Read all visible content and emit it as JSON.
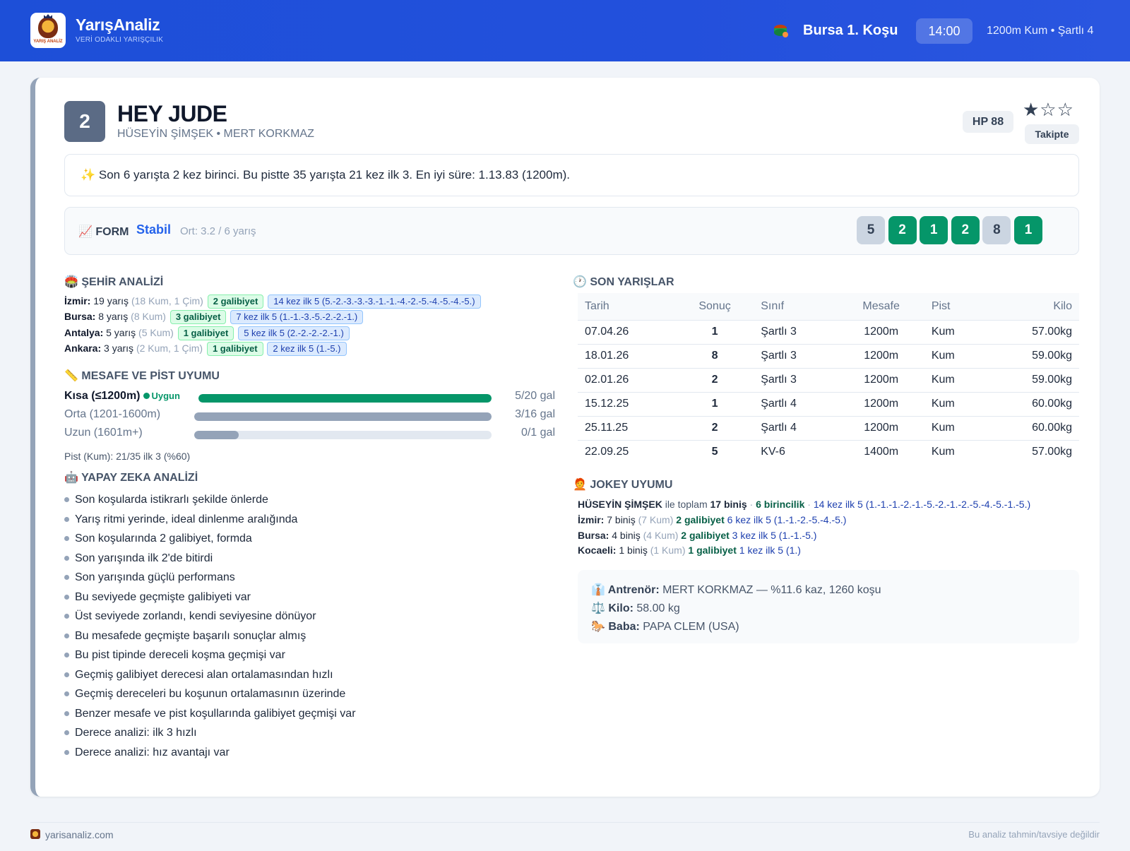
{
  "header": {
    "brand": "YarışAnaliz",
    "tagline": "VERİ ODAKLI YARIŞÇILIK",
    "logo_text": "YARIŞ ANALİZ",
    "race_title": "Bursa 1. Koşu",
    "time": "14:00",
    "race_meta": "1200m Kum • Şartlı 4"
  },
  "horse": {
    "number": "2",
    "name": "HEY JUDE",
    "subtitle": "HÜSEYİN ŞİMŞEK • MERT KORKMAZ",
    "hp": "HP 88",
    "stars": "★☆☆",
    "stars_value": 1,
    "stars_max": 3,
    "follow_label": "Takipte"
  },
  "summary": "✨ Son 6 yarışta 2 kez birinci. Bu pistte 35 yarışta 21 kez ilk 3. En iyi süre: 1.13.83 (1200m).",
  "form": {
    "label": "📈 FORM",
    "state": "Stabil",
    "avg": "Ort: 3.2 / 6 yarış",
    "results": [
      "5",
      "2",
      "1",
      "2",
      "8",
      "1"
    ],
    "colors": {
      "win": "#059669",
      "other": "#cbd5e1"
    }
  },
  "city": {
    "title": "🏟️ ŞEHİR ANALİZİ",
    "rows": [
      {
        "city": "İzmir:",
        "races": "19 yarış",
        "detail": "(18 Kum, 1 Çim)",
        "wins": "2 galibiyet",
        "top5": "14 kez ilk 5 (5.-2.-3.-3.-3.-1.-1.-4.-2.-5.-4.-5.-4.-5.)"
      },
      {
        "city": "Bursa:",
        "races": "8 yarış",
        "detail": "(8 Kum)",
        "wins": "3 galibiyet",
        "top5": "7 kez ilk 5 (1.-1.-3.-5.-2.-2.-1.)"
      },
      {
        "city": "Antalya:",
        "races": "5 yarış",
        "detail": "(5 Kum)",
        "wins": "1 galibiyet",
        "top5": "5 kez ilk 5 (2.-2.-2.-2.-1.)"
      },
      {
        "city": "Ankara:",
        "races": "3 yarış",
        "detail": "(2 Kum, 1 Çim)",
        "wins": "1 galibiyet",
        "top5": "2 kez ilk 5 (1.-5.)"
      }
    ]
  },
  "distance": {
    "title": "📏 MESAFE VE PİST UYUMU",
    "rows": [
      {
        "label": "Kısa (≤1200m)",
        "badge": "Uygun",
        "count": "5/20 gal",
        "fill": 1.0,
        "color": "#059669"
      },
      {
        "label": "Orta (1201-1600m)",
        "badge": "",
        "count": "3/16 gal",
        "fill": 1.0,
        "color": "#94a3b8"
      },
      {
        "label": "Uzun (1601m+)",
        "badge": "",
        "count": "0/1 gal",
        "fill": 0.15,
        "color": "#94a3b8"
      }
    ],
    "pist": "Pist (Kum): 21/35 ilk 3 (%60)"
  },
  "ai": {
    "title": "🤖 YAPAY ZEKA ANALİZİ",
    "items": [
      "Son koşularda istikrarlı şekilde önlerde",
      "Yarış ritmi yerinde, ideal dinlenme aralığında",
      "Son koşularında 2 galibiyet, formda",
      "Son yarışında ilk 2'de bitirdi",
      "Son yarışında güçlü performans",
      "Bu seviyede geçmişte galibiyeti var",
      "Üst seviyede zorlandı, kendi seviyesine dönüyor",
      "Bu mesafede geçmişte başarılı sonuçlar almış",
      "Bu pist tipinde dereceli koşma geçmişi var",
      "Geçmiş galibiyet derecesi alan ortalamasından hızlı",
      "Geçmiş dereceleri bu koşunun ortalamasının üzerinde",
      "Benzer mesafe ve pist koşullarında galibiyet geçmişi var",
      "Derece analizi: ilk 3 hızlı",
      "Derece analizi: hız avantajı var"
    ]
  },
  "races": {
    "title": "🕐 SON YARIŞLAR",
    "headers": [
      "Tarih",
      "Sonuç",
      "Sınıf",
      "Mesafe",
      "Pist",
      "Kilo"
    ],
    "rows": [
      {
        "date": "07.04.26",
        "result": "1",
        "class": "Şartlı 3",
        "distance": "1200m",
        "track": "Kum",
        "weight": "57.00kg"
      },
      {
        "date": "18.01.26",
        "result": "8",
        "class": "Şartlı 3",
        "distance": "1200m",
        "track": "Kum",
        "weight": "59.00kg"
      },
      {
        "date": "02.01.26",
        "result": "2",
        "class": "Şartlı 3",
        "distance": "1200m",
        "track": "Kum",
        "weight": "59.00kg"
      },
      {
        "date": "15.12.25",
        "result": "1",
        "class": "Şartlı 4",
        "distance": "1200m",
        "track": "Kum",
        "weight": "60.00kg"
      },
      {
        "date": "25.11.25",
        "result": "2",
        "class": "Şartlı 4",
        "distance": "1200m",
        "track": "Kum",
        "weight": "60.00kg"
      },
      {
        "date": "22.09.25",
        "result": "5",
        "class": "KV-6",
        "distance": "1400m",
        "track": "Kum",
        "weight": "57.00kg"
      }
    ]
  },
  "jockey": {
    "title": "🧑‍🦰 JOKEY UYUMU",
    "name": "HÜSEYİN ŞİMŞEK",
    "mid": " ile toplam ",
    "total": "17 biniş",
    "sep": " · ",
    "wins": "6 birincilik",
    "sep2": " · ",
    "top5": "14 kez ilk 5 (1.-1.-1.-2.-1.-5.-2.-1.-2.-5.-4.-5.-1.-5.)",
    "cities": [
      {
        "city": "İzmir:",
        "rides": " 7 biniş ",
        "detail": "(7 Kum)",
        "wins": " 2 galibiyet",
        "top5": " 6 kez ilk 5 (1.-1.-2.-5.-4.-5.)"
      },
      {
        "city": "Bursa:",
        "rides": " 4 biniş ",
        "detail": "(4 Kum)",
        "wins": " 2 galibiyet",
        "top5": " 3 kez ilk 5 (1.-1.-5.)"
      },
      {
        "city": "Kocaeli:",
        "rides": " 1 biniş ",
        "detail": "(1 Kum)",
        "wins": " 1 galibiyet",
        "top5": " 1 kez ilk 5 (1.)"
      }
    ]
  },
  "info": {
    "trainer_label": "👔 Antrenör:",
    "trainer_value": " MERT KORKMAZ — %11.6 kaz, 1260 koşu",
    "weight_label": "⚖️ Kilo:",
    "weight_value": " 58.00 kg",
    "sire_label": "🐎 Baba:",
    "sire_value": " PAPA CLEM (USA)"
  },
  "footer": {
    "site": "yarisanaliz.com",
    "disclaimer": "Bu analiz tahmin/tavsiye değildir"
  }
}
